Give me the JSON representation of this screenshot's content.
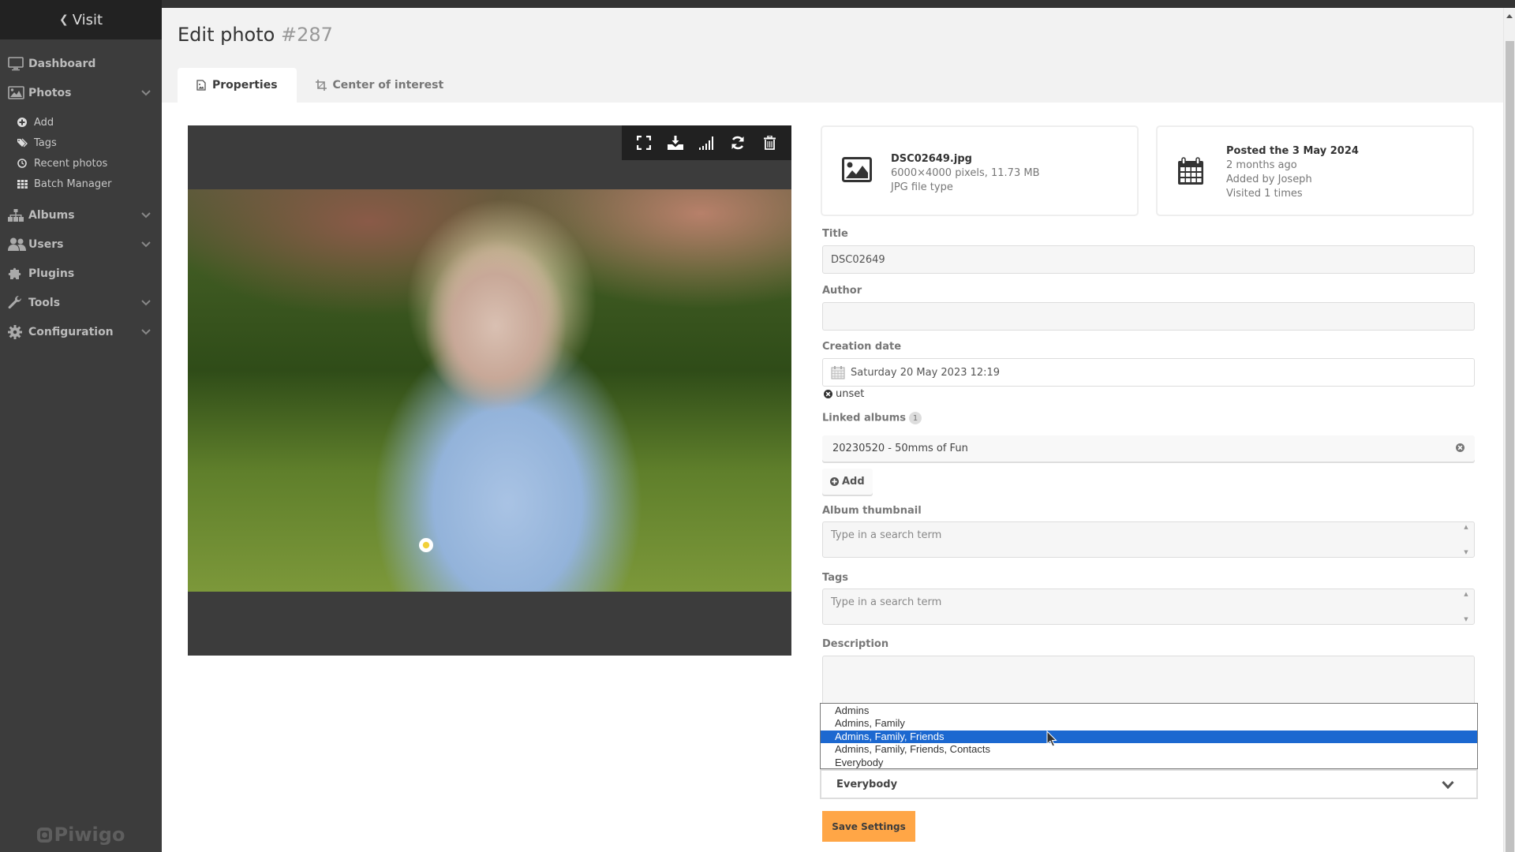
{
  "sidebar": {
    "visit_label": "Visit",
    "items": [
      {
        "label": "Dashboard",
        "icon": "monitor-icon"
      },
      {
        "label": "Photos",
        "icon": "image-icon",
        "expandable": true
      },
      {
        "label": "Albums",
        "icon": "sitemap-icon",
        "expandable": true
      },
      {
        "label": "Users",
        "icon": "users-icon",
        "expandable": true
      },
      {
        "label": "Plugins",
        "icon": "puzzle-icon"
      },
      {
        "label": "Tools",
        "icon": "wrench-icon",
        "expandable": true
      },
      {
        "label": "Configuration",
        "icon": "gear-icon",
        "expandable": true
      }
    ],
    "photos_sub": [
      {
        "label": "Add",
        "icon": "plus-circle-icon"
      },
      {
        "label": "Tags",
        "icon": "tags-icon"
      },
      {
        "label": "Recent photos",
        "icon": "clock-icon"
      },
      {
        "label": "Batch Manager",
        "icon": "grid-icon"
      }
    ],
    "brand": "Piwigo"
  },
  "page": {
    "title": "Edit photo",
    "photo_id": "#287"
  },
  "tabs": [
    {
      "label": "Properties",
      "active": true
    },
    {
      "label": "Center of interest",
      "active": false
    }
  ],
  "photo_toolbar": [
    "fullscreen-icon",
    "download-icon",
    "signal-icon",
    "sync-icon",
    "trash-icon"
  ],
  "file_card": {
    "filename": "DSC02649.jpg",
    "dimensions": "6000×4000 pixels, 11.73 MB",
    "filetype": "JPG file type"
  },
  "post_card": {
    "posted": "Posted the 3 May 2024",
    "ago": "2 months ago",
    "added_by": "Added by Joseph",
    "visits": "Visited 1 times"
  },
  "form": {
    "title_label": "Title",
    "title_value": "DSC02649",
    "author_label": "Author",
    "author_value": "",
    "creation_label": "Creation date",
    "creation_value": "Saturday 20 May 2023 12:19",
    "unset_label": "unset",
    "linked_albums_label": "Linked albums",
    "linked_albums_count": "1",
    "linked_albums": [
      "20230520 - 50mms of Fun"
    ],
    "add_label": "Add",
    "thumbnail_label": "Album thumbnail",
    "thumbnail_placeholder": "Type in a search term",
    "tags_label": "Tags",
    "tags_placeholder": "Type in a search term",
    "description_label": "Description",
    "privacy_options": [
      "Admins",
      "Admins, Family",
      "Admins, Family, Friends",
      "Admins, Family, Friends, Contacts",
      "Everybody"
    ],
    "privacy_highlighted": "Admins, Family, Friends",
    "privacy_selected": "Everybody",
    "save_label": "Save Settings"
  },
  "colors": {
    "accent": "#ffa646",
    "highlight": "#1c68d0",
    "sidebar_bg": "#3c3c3c"
  }
}
